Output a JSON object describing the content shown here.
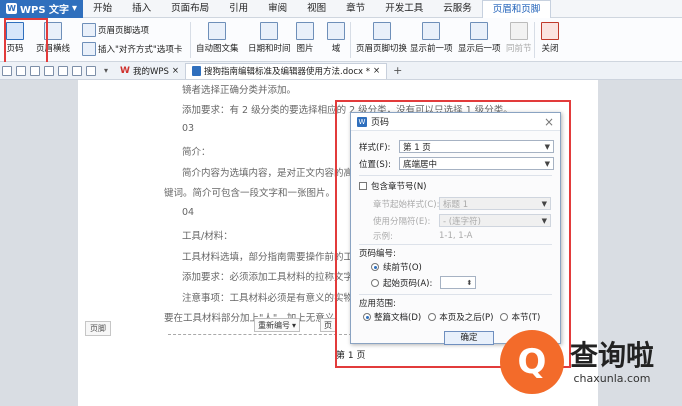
{
  "menubar": {
    "app_button": "WPS 文字",
    "items": [
      "开始",
      "插入",
      "页面布局",
      "引用",
      "审阅",
      "视图",
      "章节",
      "开发工具",
      "云服务",
      "页眉和页脚"
    ]
  },
  "ribbon": {
    "page_number": "页码",
    "header_line": "页眉横线",
    "header_footer_options": "页眉页脚选项",
    "insert_align_tab": "插入\"对齐方式\"选项卡",
    "auto_text": "自动图文集",
    "date_time": "日期和时间",
    "picture": "图片",
    "field": "域",
    "switch_hf": "页眉页脚切换",
    "show_prev": "显示前一项",
    "show_next": "显示后一项",
    "same_as_prev": "同前节",
    "close": "关闭"
  },
  "tabs": {
    "my_wps": "我的WPS",
    "doc_name": "搜狗指南编辑标准及编辑器使用方法.docx *",
    "add": "+"
  },
  "document": {
    "lines": [
      "镜者选择正确分类并添加。",
      "添加要求：有 2 级分类的要选择相应的 2 级分类，没有可以只选择 1 级分类。",
      "03",
      "简介：",
      "简介内容为选填内容，是对正文内容的高度概括",
      "键词。简介可包含一段文字和一张图片。",
      "04",
      "工具/材料：",
      "工具材料选填，部分指南需要操作前的工",
      "添加要求：必须添加工具材料的拉称文字",
      "注意事项：工具材料必须是有意义的实物",
      "要在工具材料部分加上\"人\"，加上无意义"
    ],
    "footer_label": "页脚",
    "renumber_btn": "重新编号",
    "page_btn": "页",
    "page_text": "第 1 页"
  },
  "dialog": {
    "title": "页码",
    "style_label": "样式(F):",
    "style_value": "第 1 页",
    "position_label": "位置(S):",
    "position_value": "底端居中",
    "include_chapter": "包含章节号(N)",
    "chapter_style_label": "章节起始样式(C):",
    "chapter_style_value": "标题 1",
    "separator_label": "使用分隔符(E):",
    "separator_value": "- (连字符)",
    "example_label": "示例:",
    "example_value": "1-1, 1-A",
    "numbering_section": "页码编号:",
    "continue_prev": "续前节(O)",
    "start_at": "起始页码(A):",
    "apply_section": "应用范围:",
    "apply_whole": "整篇文档(D)",
    "apply_this_after": "本页及之后(P)",
    "apply_this_section": "本节(T)",
    "ok": "确定"
  },
  "watermark": {
    "cn": "查询啦",
    "en": "chaxunla.com"
  }
}
